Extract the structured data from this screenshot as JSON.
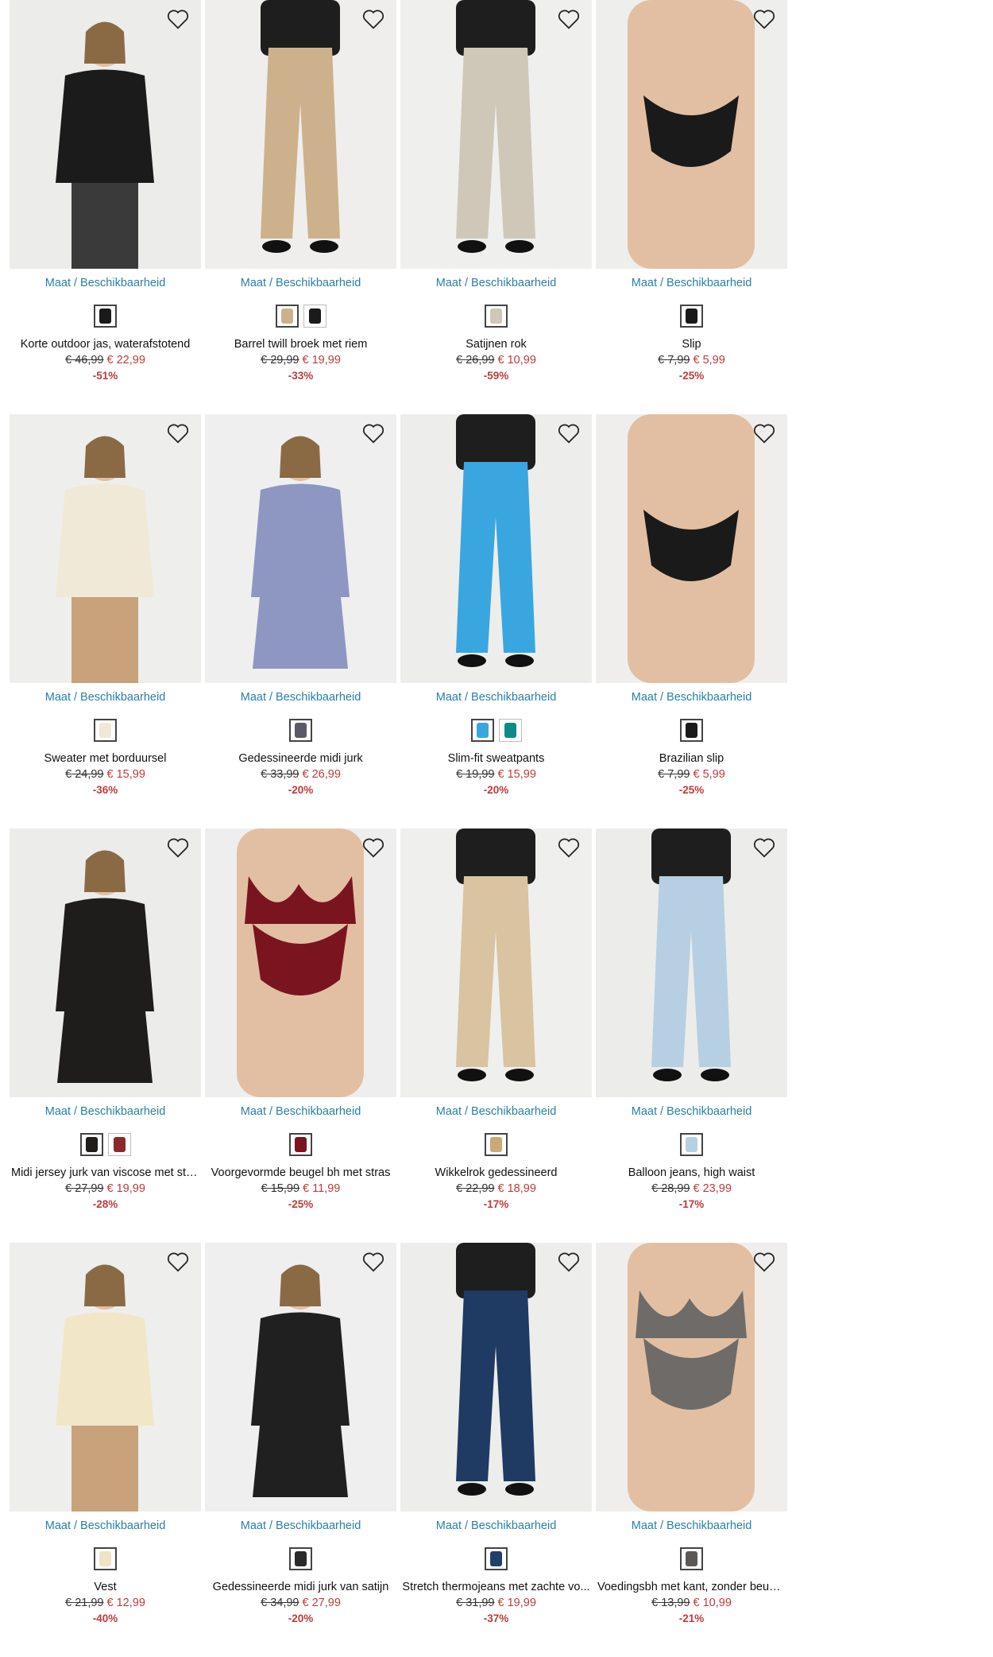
{
  "labels": {
    "size_availability": "Maat / Beschikbaarheid"
  },
  "products": [
    {
      "name": "Korte outdoor jas, waterafstotend",
      "old_price": "€ 46,99",
      "new_price": "€ 22,99",
      "discount": "-51%",
      "bg": "#ececea",
      "item_color": "#1b1b1b",
      "swatches": [
        "#1a1a1a"
      ]
    },
    {
      "name": "Barrel twill broek met riem",
      "old_price": "€ 29,99",
      "new_price": "€ 19,99",
      "discount": "-33%",
      "bg": "#efeeec",
      "item_color": "#cdb18c",
      "swatches": [
        "#cdb18c",
        "#1a1a1a"
      ]
    },
    {
      "name": "Satijnen rok",
      "old_price": "€ 26,99",
      "new_price": "€ 10,99",
      "discount": "-59%",
      "bg": "#efefee",
      "item_color": "#cfc8b8",
      "swatches": [
        "#cfc8b8"
      ]
    },
    {
      "name": "Slip",
      "old_price": "€ 7,99",
      "new_price": "€ 5,99",
      "discount": "-25%",
      "bg": "#eeeeed",
      "item_color": "#1a1a1a",
      "swatches": [
        "#1a1a1a"
      ]
    },
    {
      "name": "Sweater met borduursel",
      "old_price": "€ 24,99",
      "new_price": "€ 15,99",
      "discount": "-36%",
      "bg": "#eeeeec",
      "item_color": "#f0e9d8",
      "swatches": [
        "#efe8d6"
      ]
    },
    {
      "name": "Gedessineerde midi jurk",
      "old_price": "€ 33,99",
      "new_price": "€ 26,99",
      "discount": "-20%",
      "bg": "#efefef",
      "item_color": "#8e97c2",
      "swatches": [
        "#5a5a66"
      ]
    },
    {
      "name": "Slim-fit sweatpants",
      "old_price": "€ 19,99",
      "new_price": "€ 15,99",
      "discount": "-20%",
      "bg": "#ededec",
      "item_color": "#3aa6e0",
      "swatches": [
        "#3aa6e0",
        "#0f8a86"
      ]
    },
    {
      "name": "Brazilian slip",
      "old_price": "€ 7,99",
      "new_price": "€ 5,99",
      "discount": "-25%",
      "bg": "#efeeed",
      "item_color": "#1a1a1a",
      "swatches": [
        "#1a1a1a"
      ]
    },
    {
      "name": "Midi jersey jurk van viscose met stri...",
      "old_price": "€ 27,99",
      "new_price": "€ 19,99",
      "discount": "-28%",
      "bg": "#ececeb",
      "item_color": "#1f1c1c",
      "swatches": [
        "#1f1c1c",
        "#8a2a2a"
      ]
    },
    {
      "name": "Voorgevormde beugel bh met stras",
      "old_price": "€ 15,99",
      "new_price": "€ 11,99",
      "discount": "-25%",
      "bg": "#efeeee",
      "item_color": "#7a1520",
      "swatches": [
        "#7a1520"
      ]
    },
    {
      "name": "Wikkelrok gedessineerd",
      "old_price": "€ 22,99",
      "new_price": "€ 18,99",
      "discount": "-17%",
      "bg": "#efefee",
      "item_color": "#d9c3a0",
      "swatches": [
        "#c9a978"
      ]
    },
    {
      "name": "Balloon jeans, high waist",
      "old_price": "€ 28,99",
      "new_price": "€ 23,99",
      "discount": "-17%",
      "bg": "#ececeb",
      "item_color": "#b7cfe2",
      "swatches": [
        "#b7cfe2"
      ]
    },
    {
      "name": "Vest",
      "old_price": "€ 21,99",
      "new_price": "€ 12,99",
      "discount": "-40%",
      "bg": "#eeeeec",
      "item_color": "#f1e6c8",
      "swatches": [
        "#efe3c4"
      ]
    },
    {
      "name": "Gedessineerde midi jurk van satijn",
      "old_price": "€ 34,99",
      "new_price": "€ 27,99",
      "discount": "-20%",
      "bg": "#efefef",
      "item_color": "#202020",
      "swatches": [
        "#2a2a2a"
      ]
    },
    {
      "name": "Stretch thermojeans met zachte vo...",
      "old_price": "€ 31,99",
      "new_price": "€ 19,99",
      "discount": "-37%",
      "bg": "#ededec",
      "item_color": "#1f3a63",
      "swatches": [
        "#23406b"
      ]
    },
    {
      "name": "Voedingsbh met kant, zonder beugels",
      "old_price": "€ 13,99",
      "new_price": "€ 10,99",
      "discount": "-21%",
      "bg": "#efeeed",
      "item_color": "#6e6b68",
      "swatches": [
        "#5b5856"
      ]
    }
  ]
}
